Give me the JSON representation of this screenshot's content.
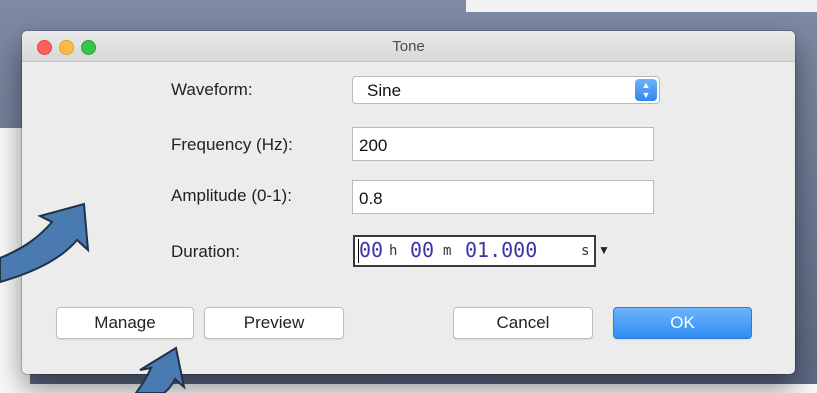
{
  "dialog": {
    "title": "Tone",
    "waveform": {
      "label": "Waveform:",
      "value": "Sine"
    },
    "frequency": {
      "label": "Frequency (Hz):",
      "value": "200"
    },
    "amplitude": {
      "label": "Amplitude (0-1):",
      "value": "0.8"
    },
    "duration": {
      "label": "Duration:",
      "hours": "00",
      "hours_unit": "h",
      "minutes": "00",
      "minutes_unit": "m",
      "seconds": "01.000",
      "seconds_unit": "s"
    },
    "buttons": {
      "manage": "Manage",
      "preview": "Preview",
      "cancel": "Cancel",
      "ok": "OK"
    }
  },
  "colors": {
    "accent": "#2f8ef2",
    "annotation_arrow": "#4a7bb0",
    "close": "#fc605c",
    "minimize": "#fdbc40",
    "zoom": "#34c84a"
  }
}
